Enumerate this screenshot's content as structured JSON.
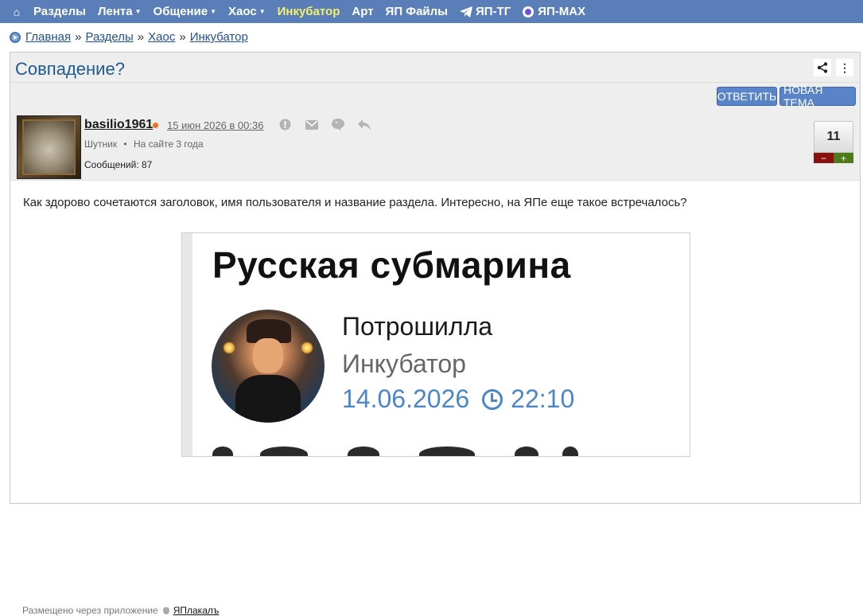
{
  "nav": {
    "items": [
      {
        "label": "Разделы",
        "caret": false,
        "active": false
      },
      {
        "label": "Лента",
        "caret": true,
        "active": false
      },
      {
        "label": "Общение",
        "caret": true,
        "active": false
      },
      {
        "label": "Хаос",
        "caret": true,
        "active": false
      },
      {
        "label": "Инкубатор",
        "caret": false,
        "active": true
      },
      {
        "label": "Арт",
        "caret": false,
        "active": false
      },
      {
        "label": "ЯП Файлы",
        "caret": false,
        "active": false
      },
      {
        "label": "ЯП-ТГ",
        "caret": false,
        "active": false
      },
      {
        "label": "ЯП-МАХ",
        "caret": false,
        "active": false
      }
    ],
    "home_icon": "home-icon",
    "colors": {
      "bar": "#5a7fb8",
      "active": "#f6ef6a"
    }
  },
  "breadcrumb": {
    "items": [
      "Главная",
      "Разделы",
      "Хаос",
      "Инкубатор"
    ],
    "separator": "»"
  },
  "topic": {
    "title": "Совпадение?",
    "reply_label": "ОТВЕТИТЬ",
    "new_topic_label": "НОВАЯ ТЕМА"
  },
  "post": {
    "username": "basilio1961",
    "date": "15 июн 2026 в 00:36",
    "rank": "Шутник",
    "dot": "•",
    "online_since": "На сайте 3 года",
    "messages": "Сообщений: 87",
    "rating": "11",
    "rating_minus": "−",
    "rating_plus": "+",
    "text": "Как здорово сочетаются заголовок, имя пользователя и название раздела. Интересно, на ЯПе еще такое встречалось?",
    "footer_prefix": "Размещено через приложение",
    "footer_app": "ЯПлакалъ"
  },
  "image": {
    "title": "Русская субмарина",
    "user": "Потрошилла",
    "section": "Инкубатор",
    "date": "14.06.2026",
    "time": "22:10"
  }
}
